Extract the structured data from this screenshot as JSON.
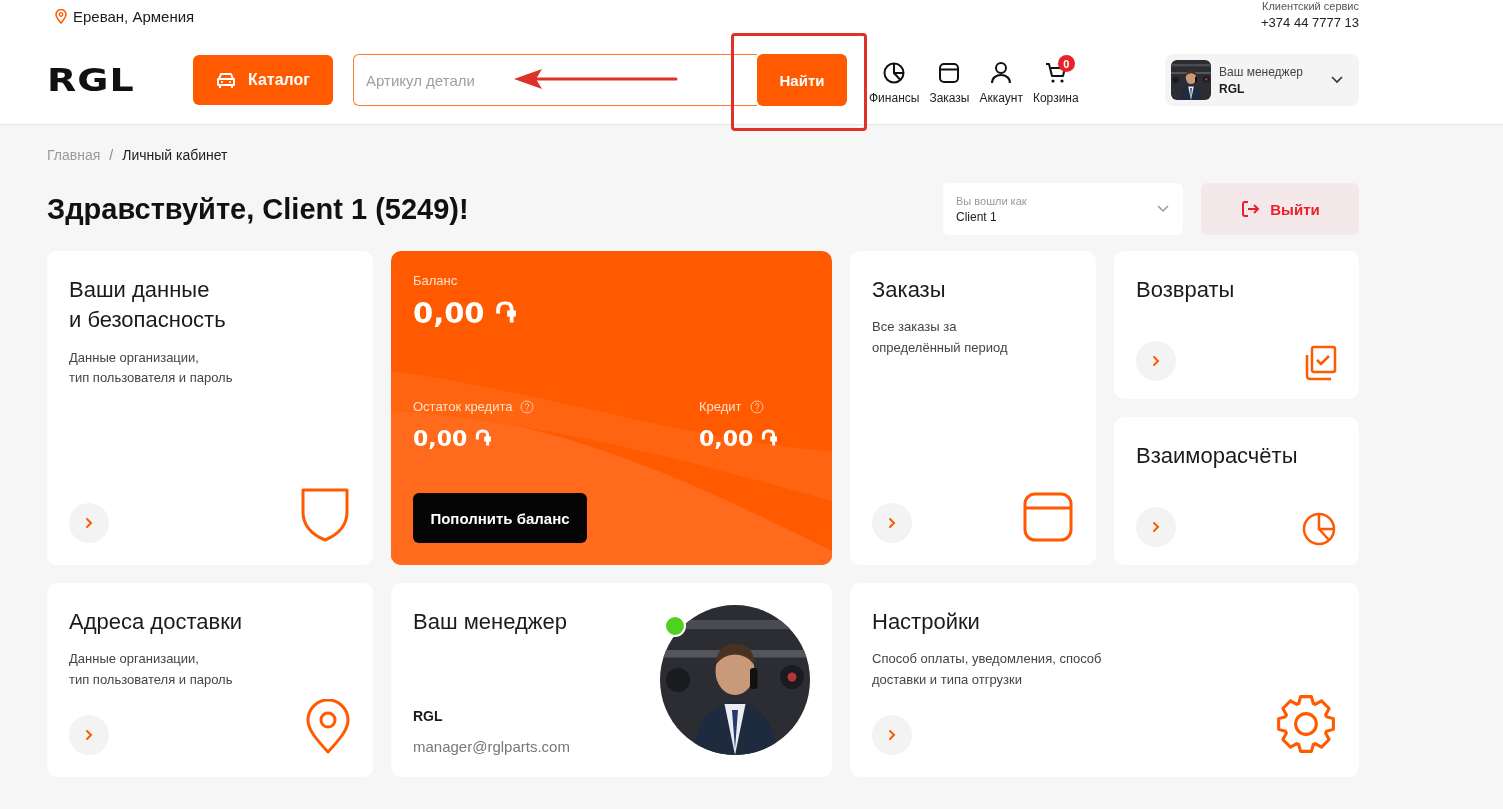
{
  "location": "Ереван, Армения",
  "support": {
    "label": "Клиентский сервис",
    "phone": "+374 44 7777 13"
  },
  "logo": "RGL",
  "catalog_button": "Каталог",
  "search": {
    "placeholder": "Артикул детали",
    "button": "Найти"
  },
  "nav": [
    {
      "label": "Финансы",
      "kind": "finance"
    },
    {
      "label": "Заказы",
      "kind": "orders"
    },
    {
      "label": "Аккаунт",
      "kind": "account"
    },
    {
      "label": "Корзина",
      "kind": "cart",
      "badge": "0"
    }
  ],
  "manager_menu": {
    "label": "Ваш менеджер",
    "name": "RGL"
  },
  "breadcrumb_separator": "/",
  "breadcrumbs": [
    {
      "label": "Главная",
      "selected": false
    },
    {
      "label": "Личный кабинет",
      "selected": true
    }
  ],
  "greeting": "Здравствуйте, Client 1 (5249)!",
  "login_as": {
    "label": "Вы вошли как",
    "value": "Client 1"
  },
  "logout_button": "Выйти",
  "cards": [
    {
      "kind": "security",
      "title": "Ваши данные\nи безопасность",
      "description": "Данные организации,\nтип пользователя и пароль"
    },
    {
      "kind": "balance",
      "balance_label": "Баланс",
      "balance": "0,00 ֏",
      "credit_left_label": "Остаток кредита",
      "credit_left": "0,00 ֏",
      "credit_label": "Кредит",
      "credit": "0,00 ֏",
      "button": "Пополнить баланс"
    },
    {
      "kind": "orders",
      "title": "Заказы",
      "description": "Все заказы за\nопределённый период"
    },
    {
      "kind": "returns",
      "title": "Возвраты"
    },
    {
      "kind": "settlements",
      "title": "Взаиморасчёты"
    },
    {
      "kind": "delivery",
      "title": "Адреса доставки",
      "description": "Данные организации,\nтип пользователя и пароль"
    },
    {
      "kind": "manager",
      "title": "Ваш менеджер",
      "name": "RGL",
      "email": "manager@rglparts.com",
      "online": true
    },
    {
      "kind": "settings",
      "title": "Настройки",
      "description": "Способ оплаты, уведомления, способ\nдоставки и типа отгрузки"
    }
  ]
}
